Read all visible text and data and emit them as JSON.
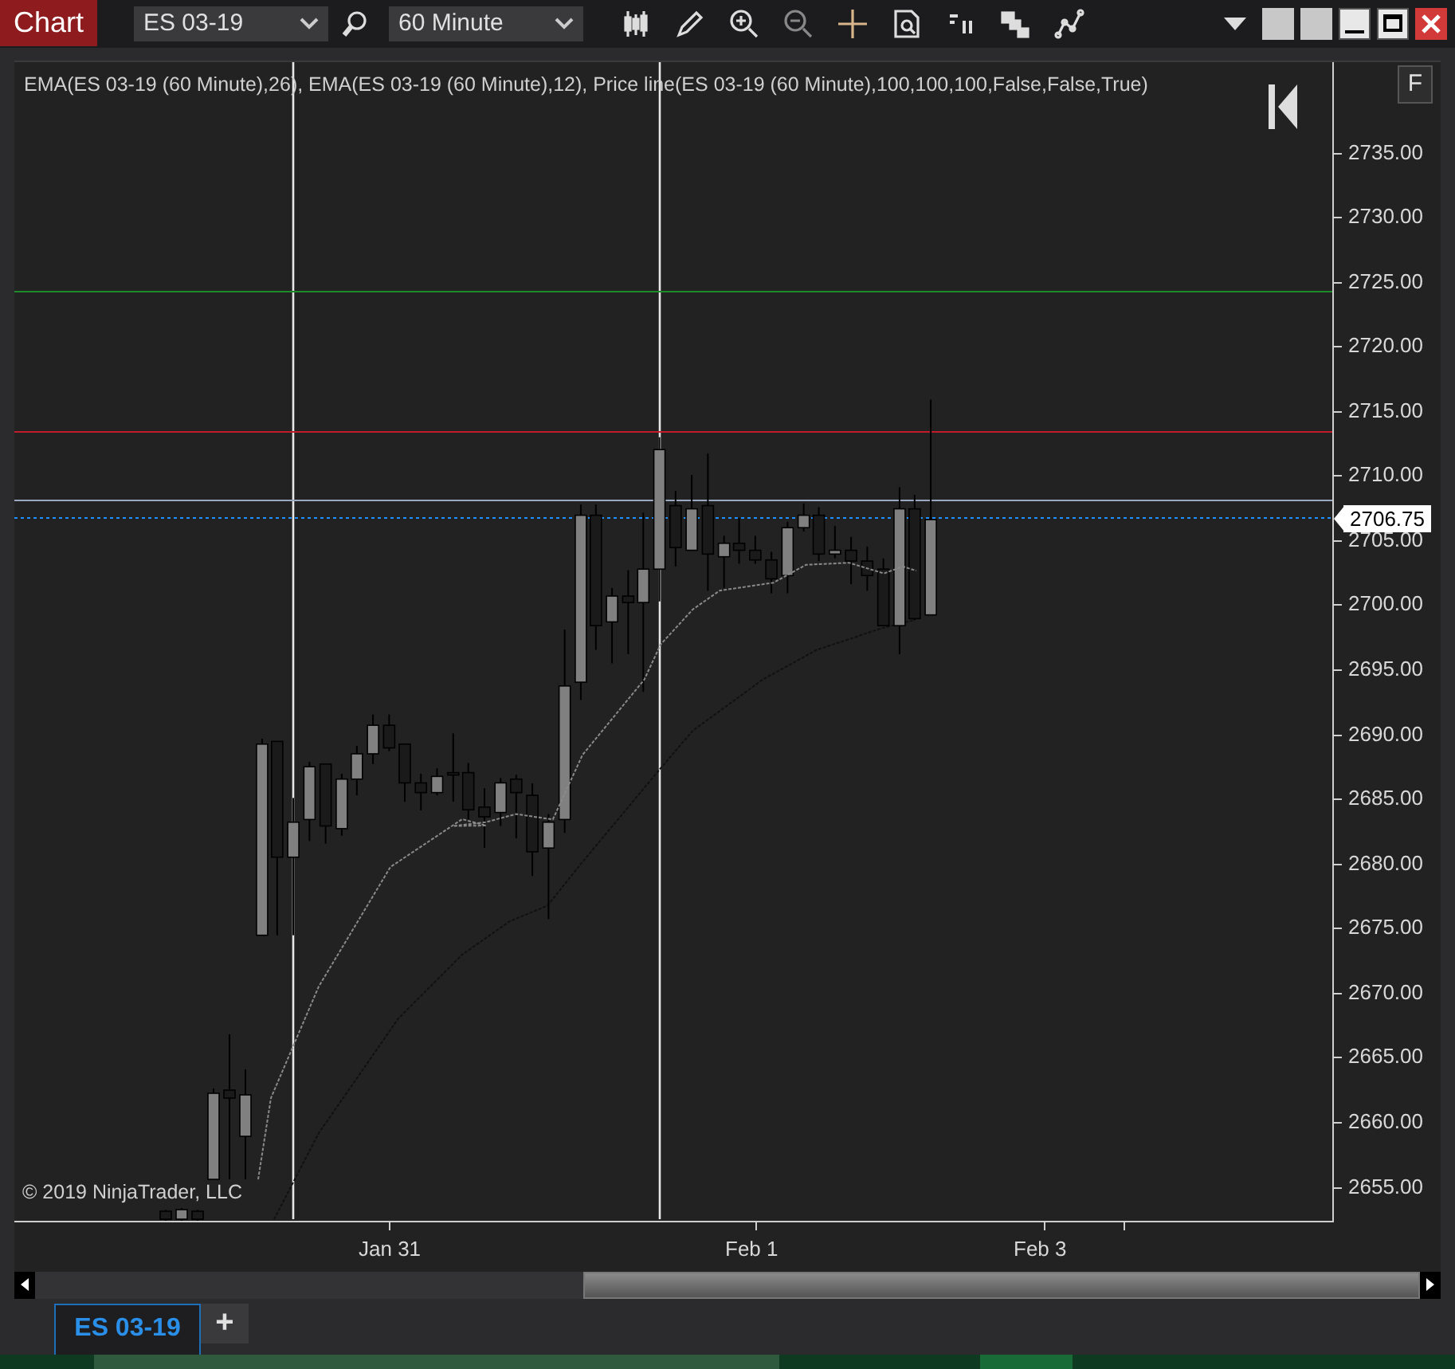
{
  "toolbar": {
    "title": "Chart",
    "instrument": "ES 03-19",
    "interval": "60 Minute"
  },
  "chart": {
    "legend": "EMA(ES 03-19 (60 Minute),26), EMA(ES 03-19 (60 Minute),12), Price line(ES 03-19 (60 Minute),100,100,100,False,False,True)",
    "f_button": "F",
    "copyright": "© 2019 NinjaTrader, LLC",
    "price_marker": "2706.75",
    "y_axis": [
      "2735.00",
      "2730.00",
      "2725.00",
      "2720.00",
      "2715.00",
      "2710.00",
      "2705.00",
      "2700.00",
      "2695.00",
      "2690.00",
      "2685.00",
      "2680.00",
      "2675.00",
      "2670.00",
      "2665.00",
      "2660.00",
      "2655.00"
    ],
    "x_axis": [
      "Jan 31",
      "Feb 1",
      "Feb 3"
    ]
  },
  "tabs": [
    {
      "label": "ES 03-19",
      "selected": true
    }
  ],
  "add_tab": "+"
}
